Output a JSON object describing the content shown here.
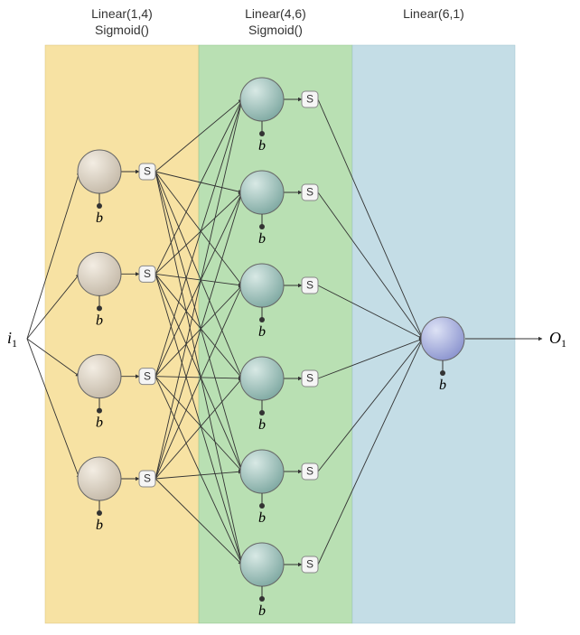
{
  "layers": [
    {
      "title_line1": "Linear(1,4)",
      "title_line2": "Sigmoid()",
      "bg": "#f7e2a3"
    },
    {
      "title_line1": "Linear(4,6)",
      "title_line2": "Sigmoid()",
      "bg": "#b9e0b3"
    },
    {
      "title_line1": "Linear(6,1)",
      "title_line2": "",
      "bg": "#c4dde6"
    }
  ],
  "input_label": {
    "letter": "i",
    "sub": "1"
  },
  "output_label": {
    "letter": "O",
    "sub": "1"
  },
  "bias_label": "b",
  "activation_label": "S",
  "layer1_neurons": 4,
  "layer2_neurons": 6,
  "layer3_neurons": 1,
  "layer1_has_activation": true,
  "layer2_has_activation": true,
  "layer3_has_activation": false,
  "colors": {
    "layer1_neuron_top": "#ede6da",
    "layer1_neuron_bot": "#c9bfb1",
    "layer2_neuron_top": "#cfe3df",
    "layer2_neuron_bot": "#8fb6b0",
    "layer3_neuron_top": "#d0d6ef",
    "layer3_neuron_bot": "#99a1d4",
    "layer1_bg": "#f7e2a3",
    "layer2_bg": "#b9e0b3",
    "layer3_bg": "#c4dde6"
  }
}
